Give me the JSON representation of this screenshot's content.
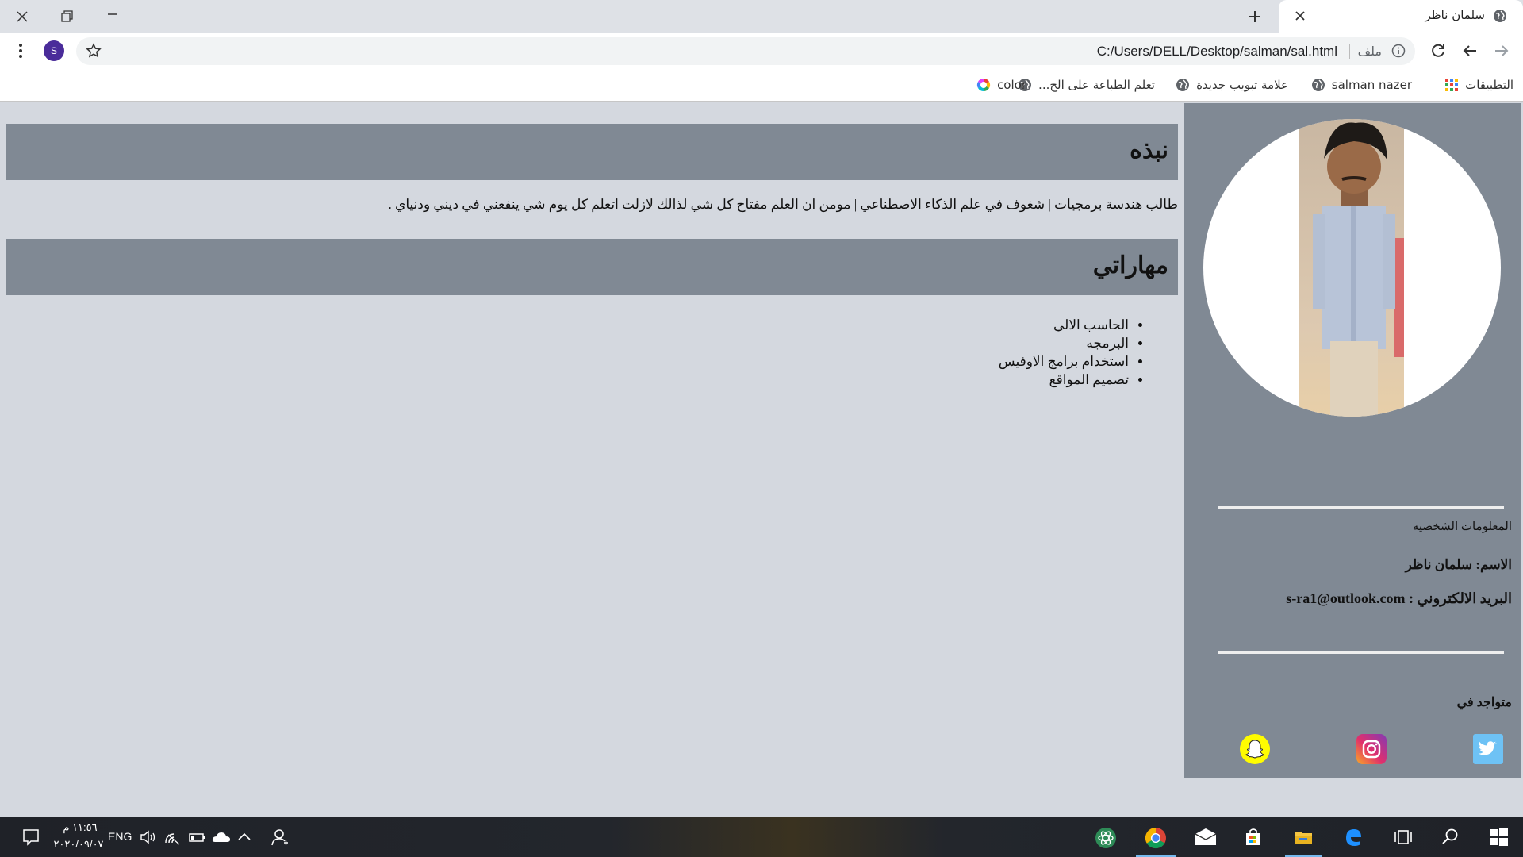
{
  "browser": {
    "tab_title": "سلمان ناظر",
    "url": "C:/Users/DELL/Desktop/salman/sal.html",
    "file_label": "ملف",
    "profile_initial": "S",
    "bookmarks": [
      {
        "label": "التطبيقات",
        "icon": "apps-grid-icon"
      },
      {
        "label": "salman nazer",
        "icon": "globe-icon"
      },
      {
        "label": "علامة تبويب جديدة",
        "icon": "globe-icon"
      },
      {
        "label": "تعلم الطباعة على الح...",
        "icon": "globe-icon"
      },
      {
        "label": "color",
        "icon": "color-wheel-icon"
      }
    ]
  },
  "page": {
    "about_heading": "نبذه",
    "about_text": "طالب هندسة برمجيات | شغوف في علم الذكاء الاصطناعي | مومن ان العلم مفتاح كل شي لذالك لازلت اتعلم كل يوم شي ينفعني في ديني ودنياي .",
    "skills_heading": "مهاراتي",
    "skills": [
      "الحاسب الالي",
      "البرمجه",
      "استخدام برامج الاوفيس",
      "تصميم المواقع"
    ],
    "sidebar": {
      "personal_info_label": "المعلومات الشخصيه",
      "name_line": "الاسم: سلمان ناظر",
      "email_line": "البريد الالكتروني : s-ra1@outlook.com",
      "located_label": "متواجد في",
      "social": [
        "twitter-icon",
        "instagram-icon",
        "snapchat-icon"
      ]
    }
  },
  "taskbar": {
    "time": "١١:٥٦ م",
    "date": "٢٠٢٠/٠٩/٠٧",
    "language": "ENG"
  },
  "colors": {
    "heading_bg": "#808994",
    "page_bg": "#d4d8df",
    "sidebar_bg": "#808994"
  }
}
